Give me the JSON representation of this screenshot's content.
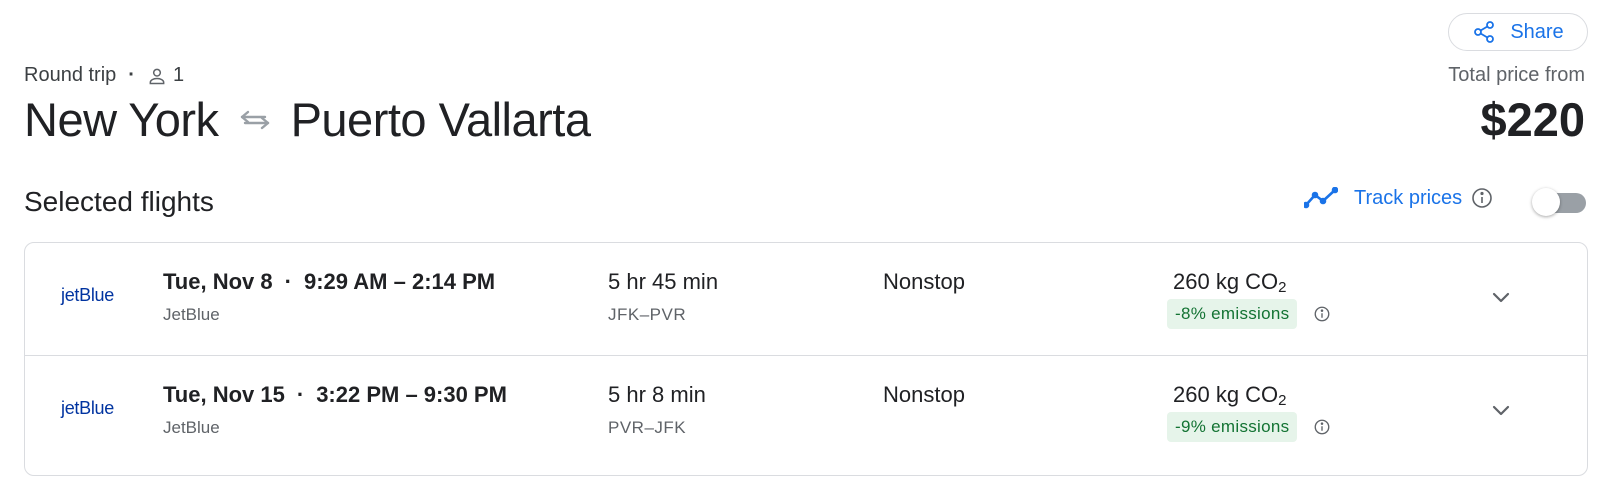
{
  "share": {
    "label": "Share",
    "icon": "share-icon"
  },
  "trip": {
    "type": "Round trip",
    "separator": "·",
    "passengers": "1"
  },
  "route": {
    "origin": "New York",
    "destination": "Puerto Vallarta"
  },
  "price": {
    "label": "Total price from",
    "value": "$220"
  },
  "section": {
    "title": "Selected flights"
  },
  "track": {
    "label": "Track prices",
    "enabled": false
  },
  "flights": [
    {
      "logo": "jetBlue",
      "date": "Tue, Nov 8",
      "times": "9:29 AM – 2:14 PM",
      "airline": "JetBlue",
      "duration": "5 hr 45 min",
      "airports": "JFK–PVR",
      "stops": "Nonstop",
      "co2": "260 kg CO",
      "co2_sub": "2",
      "emissions": "-8% emissions"
    },
    {
      "logo": "jetBlue",
      "date": "Tue, Nov 15",
      "times": "3:22 PM – 9:30 PM",
      "airline": "JetBlue",
      "duration": "5 hr 8 min",
      "airports": "PVR–JFK",
      "stops": "Nonstop",
      "co2": "260 kg CO",
      "co2_sub": "2",
      "emissions": "-9% emissions"
    }
  ],
  "colors": {
    "accent": "#1a73e8",
    "emissions_bg": "#e6f4ea",
    "emissions_text": "#137333",
    "jetblue": "#0033a0"
  }
}
